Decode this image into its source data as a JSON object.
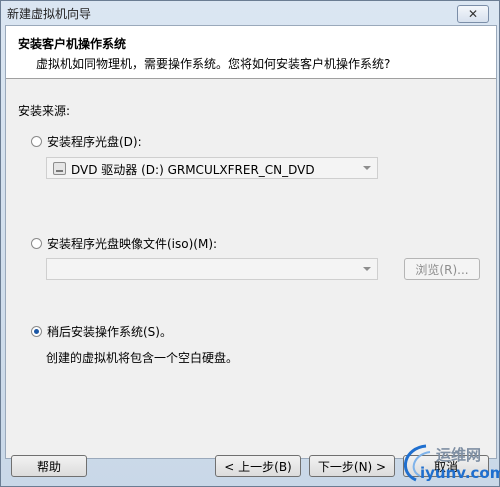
{
  "window": {
    "title": "新建虚拟机向导",
    "close_glyph": "✕"
  },
  "header": {
    "title": "安装客户机操作系统",
    "subtitle": "虚拟机如同物理机，需要操作系统。您将如何安装客户机操作系统?"
  },
  "install_source": {
    "label": "安装来源:",
    "options": [
      {
        "label": "安装程序光盘(D):",
        "selected": false
      },
      {
        "label": "安装程序光盘映像文件(iso)(M):",
        "selected": false
      },
      {
        "label": "稍后安装操作系统(S)。",
        "selected": true
      }
    ],
    "disc_combo": {
      "value": "DVD 驱动器 (D:) GRMCULXFRER_CN_DVD"
    },
    "iso_combo": {
      "value": ""
    },
    "browse_label": "浏览(R)...",
    "later_note": "创建的虚拟机将包含一个空白硬盘。"
  },
  "footer": {
    "help_label": "帮助",
    "back_label": "< 上一步(B)",
    "next_label": "下一步(N) >",
    "cancel_label": "取消"
  },
  "watermark": {
    "cn": "运维网",
    "en": "iyunv.com"
  },
  "colors": {
    "accent": "#1b57a6",
    "titlebar": "#cfdbe9"
  }
}
